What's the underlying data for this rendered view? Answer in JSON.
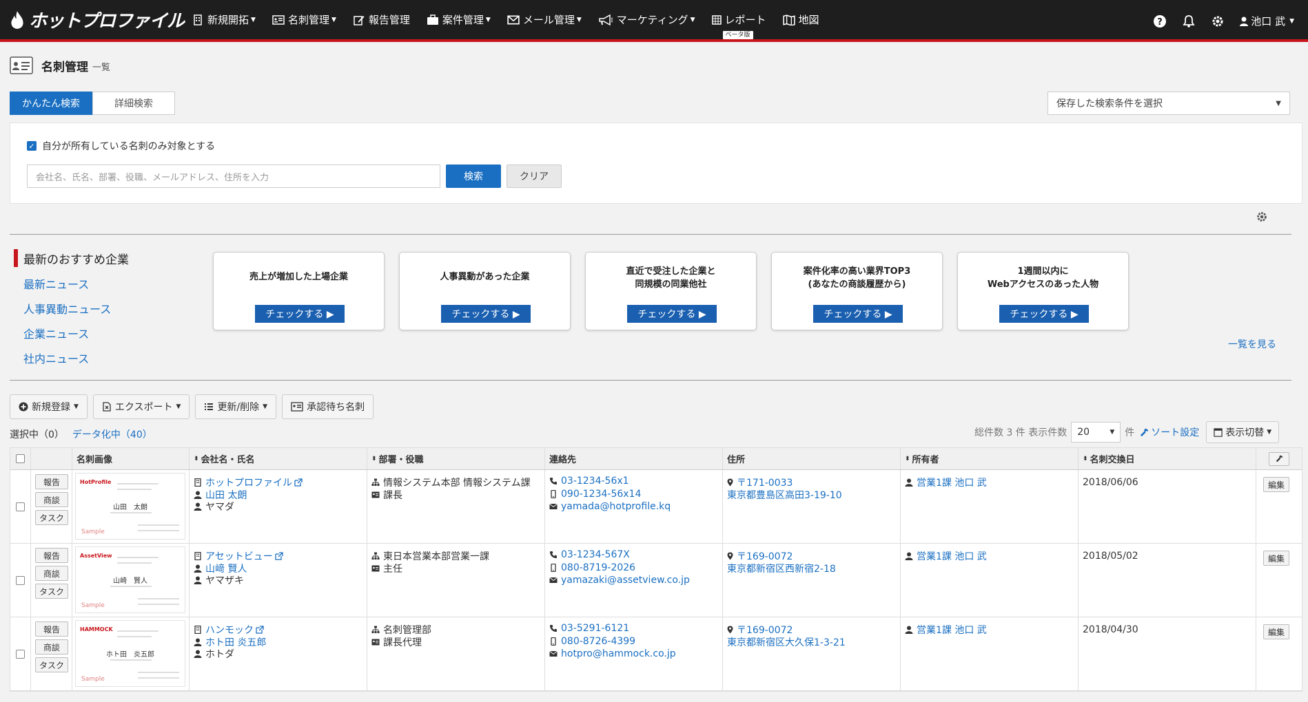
{
  "app": {
    "logo_text": "ホットプロファイル"
  },
  "nav": {
    "items": [
      {
        "label": "新規開拓",
        "icon": "building-icon",
        "caret": true
      },
      {
        "label": "名刺管理",
        "icon": "card-icon",
        "caret": true
      },
      {
        "label": "報告管理",
        "icon": "edit-icon",
        "caret": false
      },
      {
        "label": "案件管理",
        "icon": "briefcase-icon",
        "caret": true
      },
      {
        "label": "メール管理",
        "icon": "mail-icon",
        "caret": true
      },
      {
        "label": "マーケティング",
        "icon": "megaphone-icon",
        "caret": true
      },
      {
        "label": "レポート",
        "icon": "table-icon",
        "caret": false
      },
      {
        "label": "地図",
        "icon": "map-icon",
        "caret": false
      }
    ],
    "beta_badge": "ベータ版",
    "user_name": "池口 武"
  },
  "page": {
    "title": "名刺管理",
    "subtitle": "一覧"
  },
  "search": {
    "tab_easy": "かんたん検索",
    "tab_detail": "詳細検索",
    "saved_placeholder": "保存した検索条件を選択",
    "own_only_label": "自分が所有している名刺のみ対象とする",
    "placeholder": "会社名、氏名、部署、役職、メールアドレス、住所を入力",
    "search_btn": "検索",
    "clear_btn": "クリア"
  },
  "recommend": {
    "title": "最新のおすすめ企業",
    "links": [
      "最新ニュース",
      "人事異動ニュース",
      "企業ニュース",
      "社内ニュース"
    ],
    "cards": [
      {
        "text": "売上が増加した上場企業",
        "btn": "チェックする ▶"
      },
      {
        "text": "人事異動があった企業",
        "btn": "チェックする ▶"
      },
      {
        "text": "直近で受注した企業と\n同規模の同業他社",
        "btn": "チェックする ▶"
      },
      {
        "text": "案件化率の高い業界TOP3\n(あなたの商談履歴から)",
        "btn": "チェックする ▶"
      },
      {
        "text": "1週間以内に\nWebアクセスのあった人物",
        "btn": "チェックする ▶"
      }
    ],
    "view_all": "一覧を見る"
  },
  "toolbar": {
    "new_btn": "新規登録",
    "export_btn": "エクスポート",
    "update_btn": "更新/削除",
    "pending_btn": "承認待ち名刺"
  },
  "status": {
    "selected": "選択中（0）",
    "digitizing": "データ化中（40）",
    "total_label": "総件数 3 件 表示件数",
    "per_page": "20",
    "unit": "件",
    "sort_label": "ソート設定",
    "display_btn": "表示切替"
  },
  "table": {
    "headers": {
      "image": "名刺画像",
      "company": "会社名・氏名",
      "department": "部署・役職",
      "contact": "連絡先",
      "address": "住所",
      "owner": "所有者",
      "exchange_date": "名刺交換日"
    },
    "action_labels": {
      "report": "報告",
      "meeting": "商談",
      "task": "タスク",
      "edit": "編集"
    },
    "rows": [
      {
        "card_logo": "HotProfile",
        "card_name": "山田　太朗",
        "card_sample": "Sample",
        "company": "ホットプロファイル",
        "name": "山田 太朗",
        "kana": "ヤマダ",
        "department": "情報システム本部 情報システム課",
        "title": "課長",
        "phone": "03-1234-56x1",
        "mobile": "090-1234-56x14",
        "email": "yamada@hotprofile.kq",
        "zip": "〒171-0033",
        "address": "東京都豊島区高田3-19-10",
        "owner": "営業1課 池口 武",
        "date": "2018/06/06"
      },
      {
        "card_logo": "AssetView",
        "card_name": "山崎　賢人",
        "card_sample": "Sample",
        "company": "アセットビュー",
        "name": "山﨑 賢人",
        "kana": "ヤマザキ",
        "department": "東日本営業本部営業一課",
        "title": "主任",
        "phone": "03-1234-567X",
        "mobile": "080-8719-2026",
        "email": "yamazaki@assetview.co.jp",
        "zip": "〒169-0072",
        "address": "東京都新宿区西新宿2-18",
        "owner": "営業1課 池口 武",
        "date": "2018/05/02"
      },
      {
        "card_logo": "HAMMOCK",
        "card_name": "ホト田　炎五郎",
        "card_sample": "Sample",
        "company": "ハンモック",
        "name": "ホト田 炎五郎",
        "kana": "ホトダ",
        "department": "名刺管理部",
        "title": "課長代理",
        "phone": "03-5291-6121",
        "mobile": "080-8726-4399",
        "email": "hotpro@hammock.co.jp",
        "zip": "〒169-0072",
        "address": "東京都新宿区大久保1-3-21",
        "owner": "営業1課 池口 武",
        "date": "2018/04/30"
      }
    ]
  },
  "colors": {
    "accent": "#1a6fc2",
    "brand_red": "#c8161d",
    "nav_bg": "#1e1e1e"
  }
}
